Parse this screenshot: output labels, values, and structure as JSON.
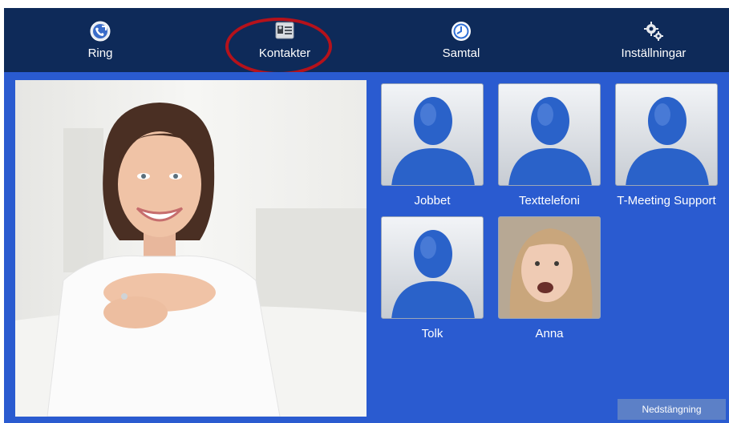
{
  "nav": {
    "items": [
      {
        "label": "Ring",
        "icon": "phone-globe-icon"
      },
      {
        "label": "Kontakter",
        "icon": "contact-card-icon"
      },
      {
        "label": "Samtal",
        "icon": "clock-icon"
      },
      {
        "label": "Inställningar",
        "icon": "gears-icon"
      }
    ],
    "highlighted": "Kontakter"
  },
  "contacts": [
    {
      "name": "Jobbet",
      "avatar": "silhouette"
    },
    {
      "name": "Texttelefoni",
      "avatar": "silhouette"
    },
    {
      "name": "T-Meeting Support",
      "avatar": "silhouette"
    },
    {
      "name": "Tolk",
      "avatar": "silhouette"
    },
    {
      "name": "Anna",
      "avatar": "photo"
    }
  ],
  "shutdown_label": "Nedstängning",
  "colors": {
    "topbar": "#0e2a59",
    "content": "#2a5bd0",
    "highlight": "#b5121b"
  }
}
